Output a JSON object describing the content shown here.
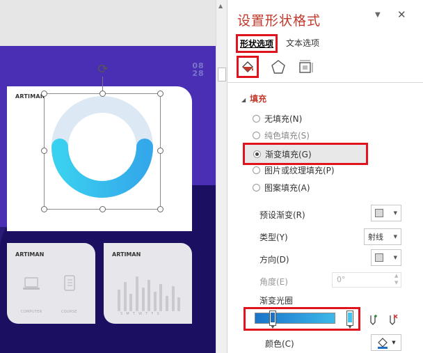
{
  "slide": {
    "date_top": "08",
    "date_bottom": "28",
    "main_card_brand": "ARTIMAN",
    "card_a": {
      "brand": "ARTIMAN",
      "label_left": "COMPUTER",
      "label_right": "COURSE"
    },
    "card_b": {
      "brand": "ARTIMAN",
      "days": "S M T W T F S",
      "bar_levels": [
        0.55,
        0.75,
        0.45,
        0.9,
        0.6,
        0.8,
        0.5,
        0.7,
        0.4,
        0.65,
        0.35
      ]
    },
    "ring": {
      "track_color": "#dde8f5",
      "gradient_from": "#3ad0ef",
      "gradient_to": "#33a8ea",
      "fill_fraction": 0.5
    }
  },
  "pane": {
    "title": "设置形状格式",
    "menu_caret": "▼",
    "close_glyph": "✕",
    "tabs": {
      "shape": "形状选项",
      "text": "文本选项"
    },
    "icon_tabs": [
      "fill-line-icon",
      "effects-icon",
      "size-properties-icon"
    ],
    "fill_section": {
      "header": "填充",
      "options": [
        {
          "label": "无填充(N)",
          "state": "off"
        },
        {
          "label": "纯色填充(S)",
          "state": "off"
        },
        {
          "label": "渐变填充(G)",
          "state": "on"
        },
        {
          "label": "图片或纹理填充(P)",
          "state": "off"
        },
        {
          "label": "图案填充(A)",
          "state": "off"
        }
      ]
    },
    "props": {
      "preset_label": "预设渐变(R)",
      "type_label": "类型(Y)",
      "type_value": "射线",
      "direction_label": "方向(D)",
      "angle_label": "角度(E)",
      "angle_value": "0°",
      "stops_label": "渐变光圈",
      "color_label": "颜色(C)"
    },
    "gradient": {
      "from": "#1a73c9",
      "to": "#3db8ea",
      "stop_colors": [
        "#1f6fc2",
        "#42c4ef"
      ]
    },
    "accent_color": "#c0392b",
    "highlight_color": "#e0141e"
  }
}
